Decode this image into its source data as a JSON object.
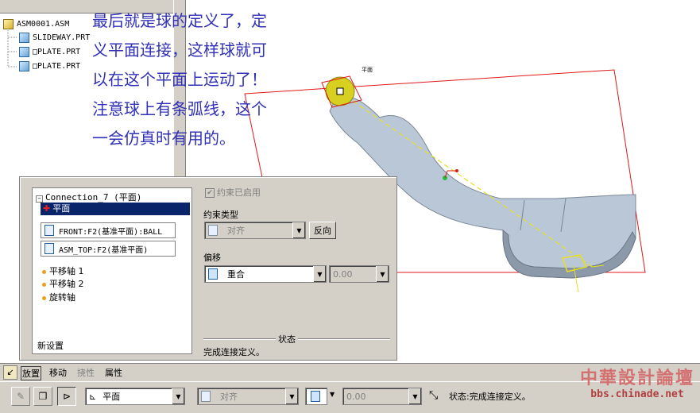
{
  "model_tree": {
    "root": "ASM0001.ASM",
    "items": [
      "SLIDEWAY.PRT",
      "□PLATE.PRT",
      "□PLATE.PRT"
    ]
  },
  "annotation": {
    "lines": [
      "最后就是球的定义了，定",
      "义平面连接，这样球就可",
      "以在这个平面上运动了！",
      "注意球上有条弧线，这个",
      "一会仿真时有用的。"
    ]
  },
  "viewport": {
    "plane_label": "平面",
    "colors": {
      "datum_plane": "#e01818",
      "part": "#b8c8d8",
      "ball": "#d8d020",
      "axis": "#e8e020"
    }
  },
  "connection_panel": {
    "title": "Connection_7 (平面)",
    "selected_item": "平面",
    "references": [
      "FRONT:F2(基准平面):BALL",
      "ASM_TOP:F2(基准平面)"
    ],
    "sub_items": [
      "平移轴 1",
      "平移轴 2",
      "旋转轴"
    ],
    "new_set": "新设置"
  },
  "constraint": {
    "enabled_label": "约束已启用",
    "enabled": true,
    "type_label": "约束类型",
    "type_value": "对齐",
    "flip_button": "反向",
    "offset_label": "偏移",
    "offset_type": "重合",
    "offset_value": "0.00",
    "status_label": "状态",
    "status_text": "完成连接定义。"
  },
  "tabs": [
    "放置",
    "移动",
    "挠性",
    "属性"
  ],
  "bottom_toolbar": {
    "connection_type": "平面",
    "constraint_type": "对齐",
    "offset_value": "0.00",
    "status": "状态:完成连接定义。"
  },
  "watermark": {
    "title": "中華設計論壇",
    "url": "bbs.chinade.net"
  }
}
